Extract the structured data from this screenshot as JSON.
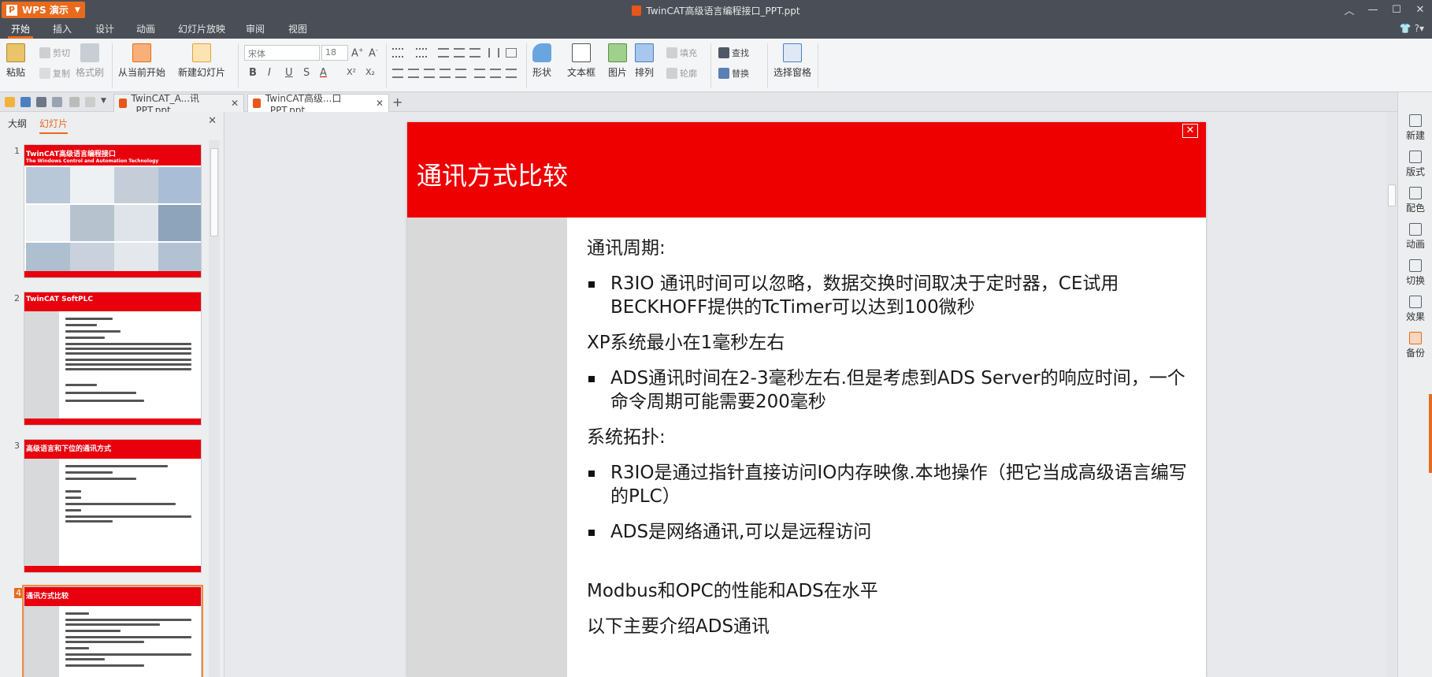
{
  "app": {
    "name": "WPS 演示",
    "logo": "P",
    "title": "TwinCAT高级语言编程接口_PPT.ppt"
  },
  "menu": {
    "tabs": [
      "开始",
      "插入",
      "设计",
      "动画",
      "幻灯片放映",
      "审阅",
      "视图"
    ],
    "active": "开始",
    "right": "?"
  },
  "ribbon": {
    "paste": "粘贴",
    "cut": "剪切",
    "copy": "复制",
    "format_painter": "格式刷",
    "from_current": "从当前开始",
    "new_slide": "新建幻灯片",
    "font_name": "宋体",
    "font_size": "18",
    "shape": "形状",
    "textbox": "文本框",
    "picture": "图片",
    "arrange": "排列",
    "fill": "填充",
    "outline": "轮廓",
    "find": "查找",
    "replace": "替换",
    "selection_pane": "选择窗格",
    "bold": "B",
    "italic": "I",
    "underline": "U",
    "strike": "S",
    "font_color": "A",
    "superscript": "X²",
    "subscript": "X₂"
  },
  "tabs": [
    {
      "label": "TwinCAT_A...讯_PPT.ppt",
      "active": false
    },
    {
      "label": "TwinCAT高级...口_PPT.ppt",
      "active": true
    }
  ],
  "left_panel": {
    "tabs": [
      "大纲",
      "幻灯片"
    ],
    "active": "幻灯片",
    "thumbnails": [
      {
        "num": "1",
        "title": "TwinCAT高级语言编程接口",
        "subtitle": "The Windows Control and Automation Technology"
      },
      {
        "num": "2",
        "title": "TwinCAT SoftPLC"
      },
      {
        "num": "3",
        "title": "高级语言和下位的通讯方式"
      },
      {
        "num": "4",
        "title": "通讯方式比较"
      }
    ]
  },
  "slide": {
    "title": "通讯方式比较",
    "items": [
      {
        "type": "para",
        "text": "通讯周期:"
      },
      {
        "type": "bullet",
        "text": "R3IO  通讯时间可以忽略，数据交换时间取决于定时器，CE试用BECKHOFF提供的TcTimer可以达到100微秒"
      },
      {
        "type": "para",
        "text": "XP系统最小在1毫秒左右"
      },
      {
        "type": "bullet",
        "text": "ADS通讯时间在2-3毫秒左右.但是考虑到ADS Server的响应时间，一个命令周期可能需要200毫秒"
      },
      {
        "type": "para",
        "text": "系统拓扑:"
      },
      {
        "type": "bullet",
        "text": "R3IO是通过指针直接访问IO内存映像.本地操作（把它当成高级语言编写的PLC）"
      },
      {
        "type": "bullet",
        "text": "ADS是网络通讯,可以是远程访问"
      },
      {
        "type": "para",
        "text": "Modbus和OPC的性能和ADS在水平"
      },
      {
        "type": "para",
        "text": "以下主要介绍ADS通讯"
      }
    ]
  },
  "sidebar": [
    "新建",
    "版式",
    "配色",
    "动画",
    "切换",
    "效果",
    "备份"
  ],
  "colors": {
    "accent": "#e86a1c",
    "slide_red": "#ee0000",
    "titlebar": "#4a4f57"
  }
}
